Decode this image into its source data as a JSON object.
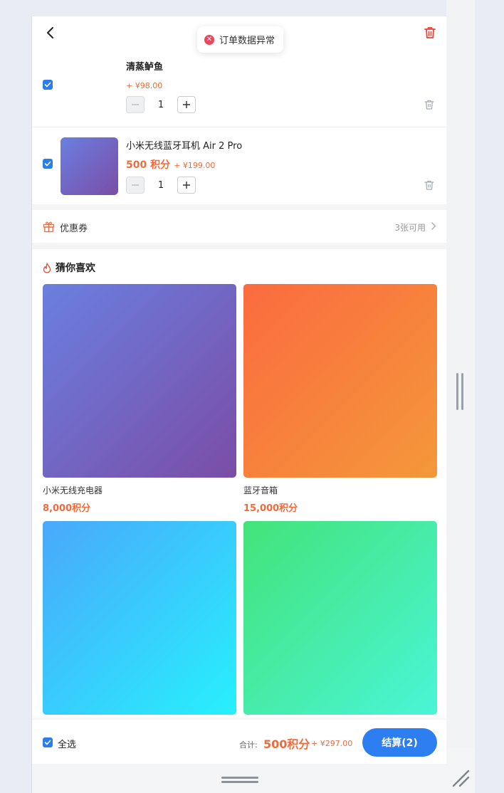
{
  "toast": {
    "message": "订单数据异常",
    "icon": "error-circle-icon",
    "color": "#f0445a"
  },
  "cart": {
    "items": [
      {
        "name": "清蒸鲈鱼",
        "points": "",
        "cash": "+ ¥98.00",
        "quantity": "1",
        "checked": true
      },
      {
        "name": "小米无线蓝牙耳机 Air 2 Pro",
        "points": "500 积分",
        "cash": "+ ¥199.00",
        "quantity": "1",
        "checked": true
      }
    ]
  },
  "coupon": {
    "label": "优惠券",
    "available": "3张可用"
  },
  "recommend": {
    "title": "猜你喜欢",
    "products": [
      {
        "name": "小米无线充电器",
        "points": "8,000积分",
        "gradient": [
          "#6b7fe0",
          "#7a4da6"
        ]
      },
      {
        "name": "蓝牙音箱",
        "points": "15,000积分",
        "gradient": [
          "#fb6b3f",
          "#f4983a"
        ]
      },
      {
        "name": "",
        "points": "",
        "gradient": [
          "#4aa8fb",
          "#27f0fd"
        ]
      },
      {
        "name": "",
        "points": "",
        "gradient": [
          "#43e37a",
          "#4af5d6"
        ]
      }
    ]
  },
  "footer": {
    "select_all_label": "全选",
    "total_label": "合计:",
    "total_points": "500积分",
    "total_cash": "+ ¥297.00",
    "checkout_label": "结算(2)"
  },
  "colors": {
    "accent": "#2d7ef0",
    "price": "#f26a3a",
    "delete": "#e8423a"
  }
}
